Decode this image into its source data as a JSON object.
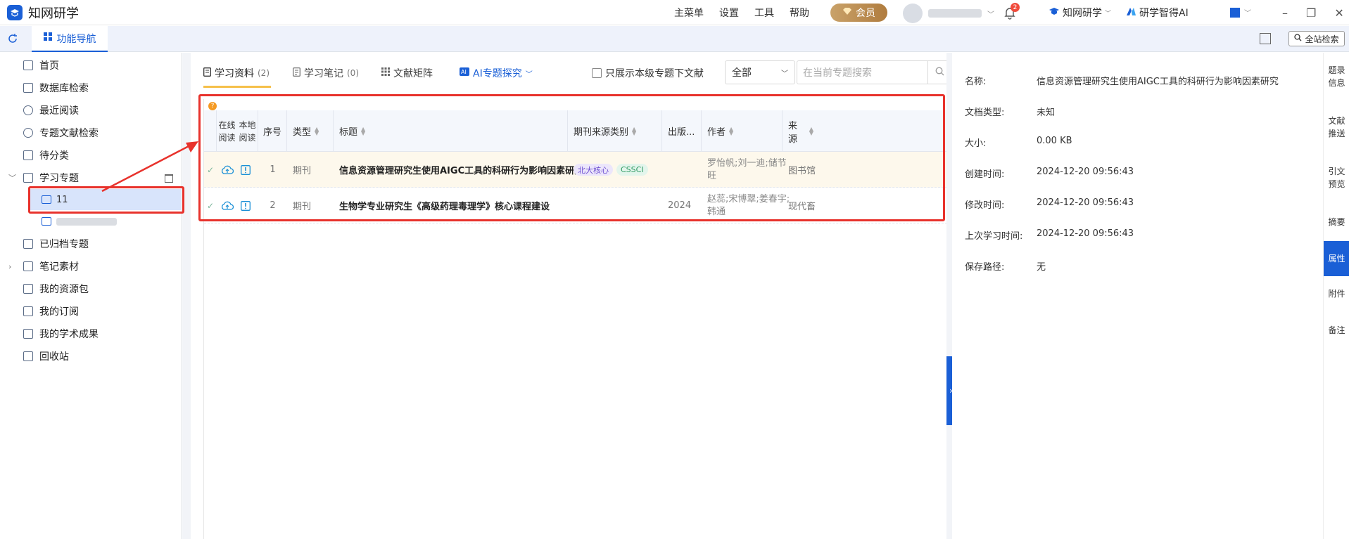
{
  "app": {
    "title": "知网研学",
    "menus": [
      "主菜单",
      "设置",
      "工具",
      "帮助"
    ],
    "vip_label": "会员",
    "notification_count": "2",
    "brand_links": [
      "知网研学",
      "研学智得AI"
    ]
  },
  "toolbar": {
    "active_tab": "功能导航",
    "global_search": "全站检索"
  },
  "sidebar": {
    "items": [
      {
        "label": "首页"
      },
      {
        "label": "数据库检索"
      },
      {
        "label": "最近阅读"
      },
      {
        "label": "专题文献检索"
      },
      {
        "label": "待分类"
      },
      {
        "label": "学习专题"
      },
      {
        "label": "已归档专题"
      },
      {
        "label": "笔记素材"
      },
      {
        "label": "我的资源包"
      },
      {
        "label": "我的订阅"
      },
      {
        "label": "我的学术成果"
      },
      {
        "label": "回收站"
      }
    ],
    "subitems": [
      {
        "label": "11"
      },
      {
        "label": ""
      }
    ]
  },
  "main": {
    "tabs": [
      {
        "label": "学习资料",
        "count": "(2)"
      },
      {
        "label": "学习笔记",
        "count": "(0)"
      },
      {
        "label": "文献矩阵",
        "count": ""
      },
      {
        "label": "AI专题探究",
        "count": ""
      }
    ],
    "only_current_label": "只展示本级专题下文献",
    "scope_value": "全部",
    "search_placeholder": "在当前专题搜索",
    "columns": {
      "online_read": "在线",
      "online_read2": "阅读",
      "local_read": "本地",
      "local_read2": "阅读",
      "index": "序号",
      "type": "类型",
      "title": "标题",
      "journal_category": "期刊来源类别",
      "pub_year": "出版...",
      "author": "作者",
      "source": "来源"
    },
    "rows": [
      {
        "index": "1",
        "type": "期刊",
        "title": "信息资源管理研究生使用AIGC工具的科研行为影响因素研究",
        "tags": [
          "北大核心",
          "CSSCI"
        ],
        "year": "",
        "author_line1": "罗怡帆;刘一迪;储节",
        "author_line2": "旺",
        "source": "图书馆"
      },
      {
        "index": "2",
        "type": "期刊",
        "title": "生物学专业研究生《高级药理毒理学》核心课程建设",
        "tags": [],
        "year": "2024",
        "author_line1": "赵蕊;宋博翠;姜春宇;",
        "author_line2": "韩通",
        "source": "现代畜"
      }
    ]
  },
  "detail": {
    "props": [
      {
        "k": "名称:",
        "v": "信息资源管理研究生使用AIGC工具的科研行为影响因素研究"
      },
      {
        "k": "文档类型:",
        "v": "未知"
      },
      {
        "k": "大小:",
        "v": "0.00 KB"
      },
      {
        "k": "创建时间:",
        "v": "2024-12-20 09:56:43"
      },
      {
        "k": "修改时间:",
        "v": "2024-12-20 09:56:43"
      },
      {
        "k": "上次学习时间:",
        "v": "2024-12-20 09:56:43"
      },
      {
        "k": "保存路径:",
        "v": "无"
      }
    ],
    "rail": [
      {
        "l1": "题录",
        "l2": "信息"
      },
      {
        "l1": "文献",
        "l2": "推送"
      },
      {
        "l1": "引文",
        "l2": "预览"
      },
      {
        "l1": "摘要",
        "l2": ""
      },
      {
        "l1": "属性",
        "l2": ""
      },
      {
        "l1": "附件",
        "l2": ""
      },
      {
        "l1": "备注",
        "l2": ""
      }
    ]
  },
  "colors": {
    "accent": "#1a5fd6",
    "highlight_red": "#e8322c",
    "vip_gold": "#b07c3e"
  }
}
